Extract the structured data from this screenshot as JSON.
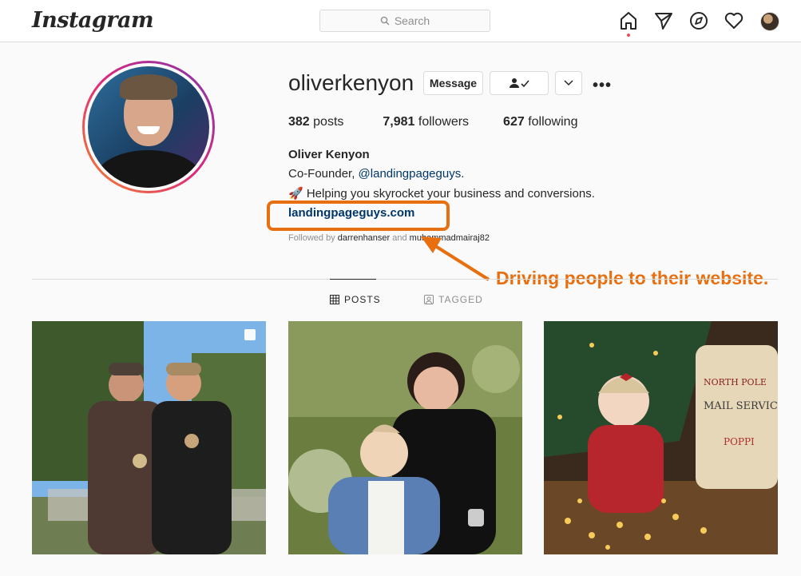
{
  "header": {
    "logo": "Instagram",
    "search_placeholder": "Search",
    "icons": [
      "home-icon",
      "direct-icon",
      "explore-icon",
      "activity-icon",
      "profile-avatar"
    ]
  },
  "profile": {
    "username": "oliverkenyon",
    "message_button": "Message",
    "follow_button_icon": "following-icon",
    "dropdown_icon": "chevron-down-icon",
    "options_icon": "more-options-icon",
    "stats": {
      "posts_count": "382",
      "posts_label": "posts",
      "followers_count": "7,981",
      "followers_label": "followers",
      "following_count": "627",
      "following_label": "following"
    },
    "full_name": "Oliver Kenyon",
    "bio_line1_prefix": "Co-Founder, ",
    "bio_line1_mention": "@landingpageguys",
    "bio_line1_suffix": ".",
    "bio_line2": "🚀 Helping you skyrocket your business and conversions.",
    "website": "landingpageguys.com",
    "followed_by_prefix": "Followed by ",
    "followed_by_user1": "darrenhanser",
    "followed_by_middle": " and ",
    "followed_by_user2": "muhammadmairaj82"
  },
  "annotation": {
    "text": "Driving people to their website.",
    "color": "#e86f0f"
  },
  "tabs": [
    {
      "label": "POSTS",
      "icon": "grid-icon",
      "active": true
    },
    {
      "label": "TAGGED",
      "icon": "tagged-icon",
      "active": false
    }
  ],
  "posts": [
    {
      "name": "post-two-men-toasting",
      "multi": true
    },
    {
      "name": "post-woman-with-baby",
      "multi": false
    },
    {
      "name": "post-baby-christmas-tree",
      "multi": false
    }
  ],
  "colors": {
    "link": "#00376b",
    "accent_orange": "#e86f0f",
    "notification_dot": "#ed4956"
  }
}
